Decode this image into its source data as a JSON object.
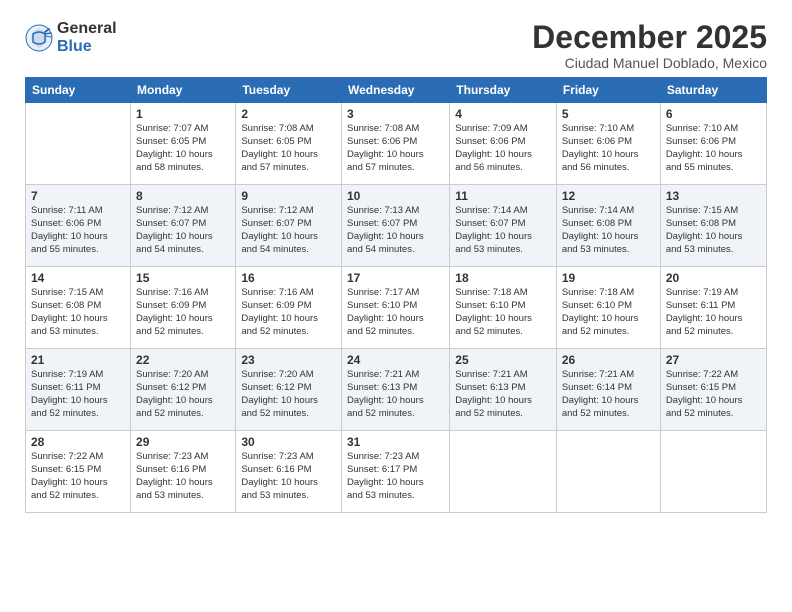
{
  "logo": {
    "general": "General",
    "blue": "Blue"
  },
  "title": "December 2025",
  "subtitle": "Ciudad Manuel Doblado, Mexico",
  "days_of_week": [
    "Sunday",
    "Monday",
    "Tuesday",
    "Wednesday",
    "Thursday",
    "Friday",
    "Saturday"
  ],
  "weeks": [
    [
      {
        "day": "",
        "info": ""
      },
      {
        "day": "1",
        "info": "Sunrise: 7:07 AM\nSunset: 6:05 PM\nDaylight: 10 hours\nand 58 minutes."
      },
      {
        "day": "2",
        "info": "Sunrise: 7:08 AM\nSunset: 6:05 PM\nDaylight: 10 hours\nand 57 minutes."
      },
      {
        "day": "3",
        "info": "Sunrise: 7:08 AM\nSunset: 6:06 PM\nDaylight: 10 hours\nand 57 minutes."
      },
      {
        "day": "4",
        "info": "Sunrise: 7:09 AM\nSunset: 6:06 PM\nDaylight: 10 hours\nand 56 minutes."
      },
      {
        "day": "5",
        "info": "Sunrise: 7:10 AM\nSunset: 6:06 PM\nDaylight: 10 hours\nand 56 minutes."
      },
      {
        "day": "6",
        "info": "Sunrise: 7:10 AM\nSunset: 6:06 PM\nDaylight: 10 hours\nand 55 minutes."
      }
    ],
    [
      {
        "day": "7",
        "info": "Sunrise: 7:11 AM\nSunset: 6:06 PM\nDaylight: 10 hours\nand 55 minutes."
      },
      {
        "day": "8",
        "info": "Sunrise: 7:12 AM\nSunset: 6:07 PM\nDaylight: 10 hours\nand 54 minutes."
      },
      {
        "day": "9",
        "info": "Sunrise: 7:12 AM\nSunset: 6:07 PM\nDaylight: 10 hours\nand 54 minutes."
      },
      {
        "day": "10",
        "info": "Sunrise: 7:13 AM\nSunset: 6:07 PM\nDaylight: 10 hours\nand 54 minutes."
      },
      {
        "day": "11",
        "info": "Sunrise: 7:14 AM\nSunset: 6:07 PM\nDaylight: 10 hours\nand 53 minutes."
      },
      {
        "day": "12",
        "info": "Sunrise: 7:14 AM\nSunset: 6:08 PM\nDaylight: 10 hours\nand 53 minutes."
      },
      {
        "day": "13",
        "info": "Sunrise: 7:15 AM\nSunset: 6:08 PM\nDaylight: 10 hours\nand 53 minutes."
      }
    ],
    [
      {
        "day": "14",
        "info": "Sunrise: 7:15 AM\nSunset: 6:08 PM\nDaylight: 10 hours\nand 53 minutes."
      },
      {
        "day": "15",
        "info": "Sunrise: 7:16 AM\nSunset: 6:09 PM\nDaylight: 10 hours\nand 52 minutes."
      },
      {
        "day": "16",
        "info": "Sunrise: 7:16 AM\nSunset: 6:09 PM\nDaylight: 10 hours\nand 52 minutes."
      },
      {
        "day": "17",
        "info": "Sunrise: 7:17 AM\nSunset: 6:10 PM\nDaylight: 10 hours\nand 52 minutes."
      },
      {
        "day": "18",
        "info": "Sunrise: 7:18 AM\nSunset: 6:10 PM\nDaylight: 10 hours\nand 52 minutes."
      },
      {
        "day": "19",
        "info": "Sunrise: 7:18 AM\nSunset: 6:10 PM\nDaylight: 10 hours\nand 52 minutes."
      },
      {
        "day": "20",
        "info": "Sunrise: 7:19 AM\nSunset: 6:11 PM\nDaylight: 10 hours\nand 52 minutes."
      }
    ],
    [
      {
        "day": "21",
        "info": "Sunrise: 7:19 AM\nSunset: 6:11 PM\nDaylight: 10 hours\nand 52 minutes."
      },
      {
        "day": "22",
        "info": "Sunrise: 7:20 AM\nSunset: 6:12 PM\nDaylight: 10 hours\nand 52 minutes."
      },
      {
        "day": "23",
        "info": "Sunrise: 7:20 AM\nSunset: 6:12 PM\nDaylight: 10 hours\nand 52 minutes."
      },
      {
        "day": "24",
        "info": "Sunrise: 7:21 AM\nSunset: 6:13 PM\nDaylight: 10 hours\nand 52 minutes."
      },
      {
        "day": "25",
        "info": "Sunrise: 7:21 AM\nSunset: 6:13 PM\nDaylight: 10 hours\nand 52 minutes."
      },
      {
        "day": "26",
        "info": "Sunrise: 7:21 AM\nSunset: 6:14 PM\nDaylight: 10 hours\nand 52 minutes."
      },
      {
        "day": "27",
        "info": "Sunrise: 7:22 AM\nSunset: 6:15 PM\nDaylight: 10 hours\nand 52 minutes."
      }
    ],
    [
      {
        "day": "28",
        "info": "Sunrise: 7:22 AM\nSunset: 6:15 PM\nDaylight: 10 hours\nand 52 minutes."
      },
      {
        "day": "29",
        "info": "Sunrise: 7:23 AM\nSunset: 6:16 PM\nDaylight: 10 hours\nand 53 minutes."
      },
      {
        "day": "30",
        "info": "Sunrise: 7:23 AM\nSunset: 6:16 PM\nDaylight: 10 hours\nand 53 minutes."
      },
      {
        "day": "31",
        "info": "Sunrise: 7:23 AM\nSunset: 6:17 PM\nDaylight: 10 hours\nand 53 minutes."
      },
      {
        "day": "",
        "info": ""
      },
      {
        "day": "",
        "info": ""
      },
      {
        "day": "",
        "info": ""
      }
    ]
  ]
}
